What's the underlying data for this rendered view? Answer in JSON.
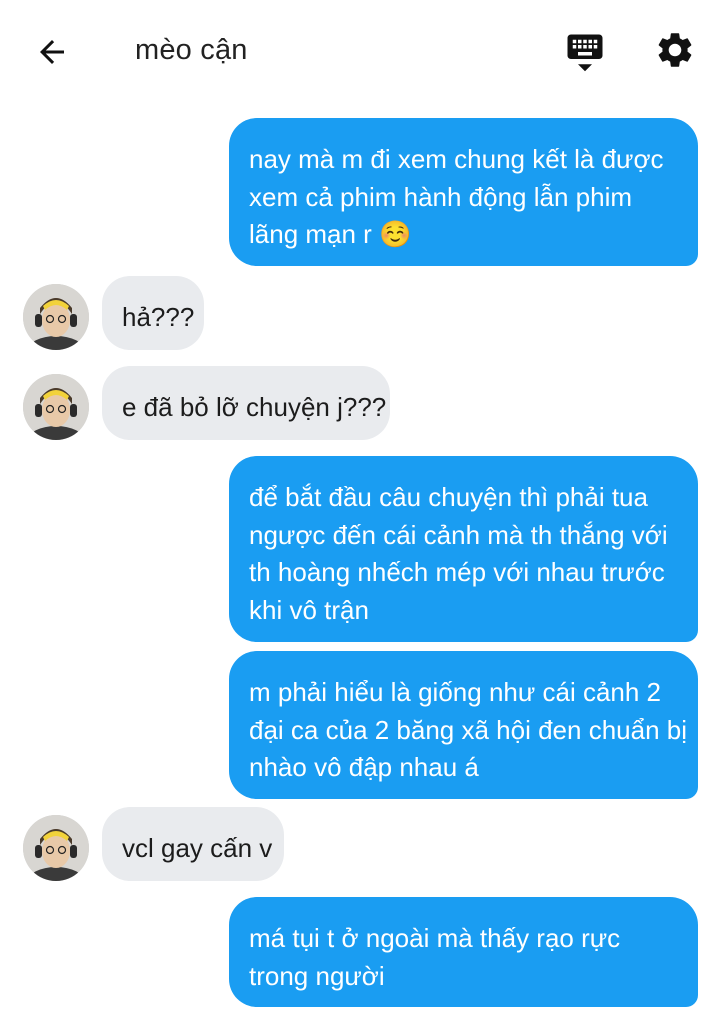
{
  "header": {
    "title": "mèo cận",
    "back_icon": "arrow-left-icon",
    "keyboard_icon": "keyboard-icon",
    "settings_icon": "gear-icon"
  },
  "messages": [
    {
      "from": "me",
      "lines": [
        "nay mà m đi xem chung kết là được",
        "xem cả phim hành động lẫn phim",
        "lãng mạn r ☺️"
      ]
    },
    {
      "from": "them",
      "lines": [
        "hả???"
      ]
    },
    {
      "from": "them",
      "lines": [
        "e đã bỏ lỡ chuyện j???"
      ]
    },
    {
      "from": "me",
      "lines": [
        "để bắt đầu câu chuyện thì phải tua",
        "ngược đến cái cảnh mà th thắng với",
        "th hoàng nhếch mép với nhau trước",
        "khi vô trận"
      ]
    },
    {
      "from": "me",
      "lines": [
        "m phải hiểu là giống như cái cảnh 2",
        "đại ca của 2 băng xã hội đen chuẩn bị",
        "nhào vô đập nhau á"
      ]
    },
    {
      "from": "them",
      "lines": [
        "vcl gay cấn v"
      ]
    },
    {
      "from": "me",
      "lines": [
        "má tụi t ở ngoài mà thấy rạo rực",
        "trong người"
      ]
    }
  ],
  "colors": {
    "sent_bubble": "#1a9df2",
    "received_bubble": "#e9ebee",
    "background": "#ffffff"
  }
}
